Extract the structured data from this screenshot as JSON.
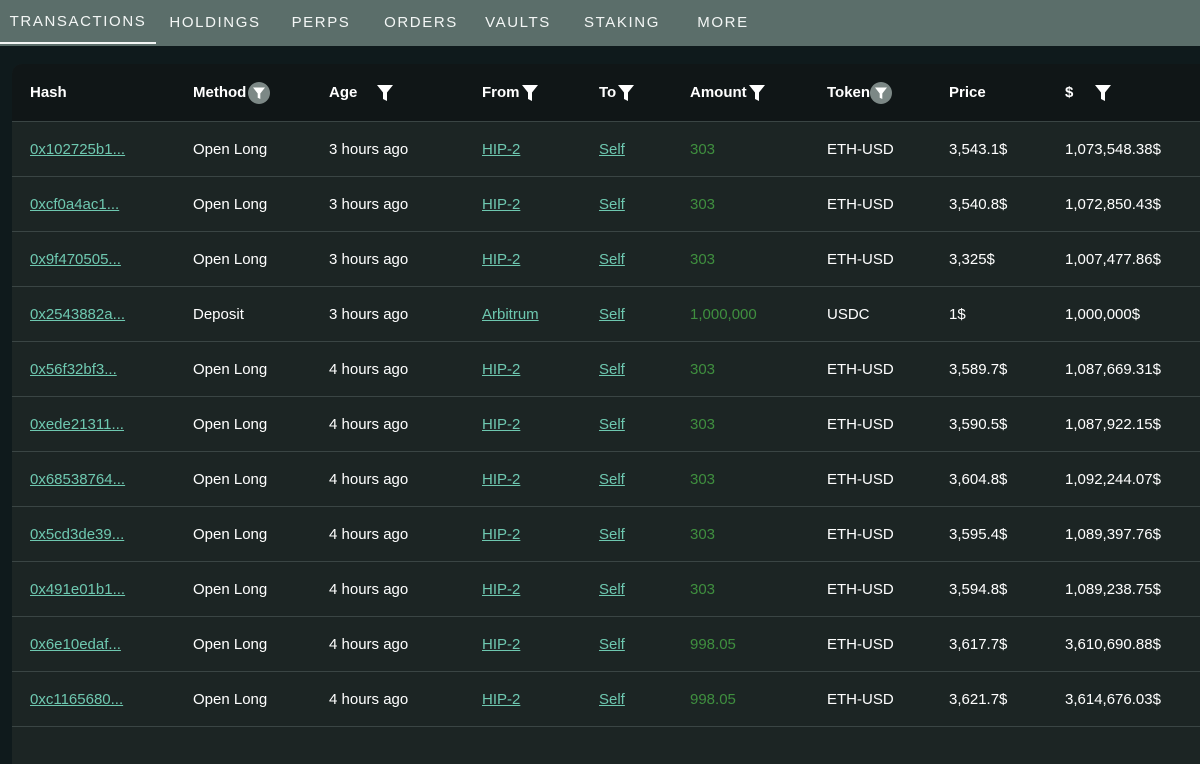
{
  "tabs": [
    {
      "label": "TRANSACTIONS",
      "active": true
    },
    {
      "label": "HOLDINGS",
      "active": false
    },
    {
      "label": "PERPS",
      "active": false
    },
    {
      "label": "ORDERS",
      "active": false
    },
    {
      "label": "VAULTS",
      "active": false
    },
    {
      "label": "STAKING",
      "active": false
    },
    {
      "label": "MORE",
      "active": false
    }
  ],
  "table": {
    "columns": {
      "hash": "Hash",
      "method": "Method",
      "age": "Age",
      "from": "From",
      "to": "To",
      "amount": "Amount",
      "token": "Token",
      "price": "Price",
      "usd": "$"
    },
    "rows": [
      {
        "hash": "0x102725b1...",
        "method": "Open Long",
        "age": "3 hours ago",
        "from": "HIP-2",
        "to": "Self",
        "amount": "303",
        "token": "ETH-USD",
        "price": "3,543.1$",
        "usd": "1,073,548.38$"
      },
      {
        "hash": "0xcf0a4ac1...",
        "method": "Open Long",
        "age": "3 hours ago",
        "from": "HIP-2",
        "to": "Self",
        "amount": "303",
        "token": "ETH-USD",
        "price": "3,540.8$",
        "usd": "1,072,850.43$"
      },
      {
        "hash": "0x9f470505...",
        "method": "Open Long",
        "age": "3 hours ago",
        "from": "HIP-2",
        "to": "Self",
        "amount": "303",
        "token": "ETH-USD",
        "price": "3,325$",
        "usd": "1,007,477.86$"
      },
      {
        "hash": "0x2543882a...",
        "method": "Deposit",
        "age": "3 hours ago",
        "from": "Arbitrum",
        "to": "Self",
        "amount": "1,000,000",
        "token": "USDC",
        "price": "1$",
        "usd": "1,000,000$"
      },
      {
        "hash": "0x56f32bf3...",
        "method": "Open Long",
        "age": "4 hours ago",
        "from": "HIP-2",
        "to": "Self",
        "amount": "303",
        "token": "ETH-USD",
        "price": "3,589.7$",
        "usd": "1,087,669.31$"
      },
      {
        "hash": "0xede21311...",
        "method": "Open Long",
        "age": "4 hours ago",
        "from": "HIP-2",
        "to": "Self",
        "amount": "303",
        "token": "ETH-USD",
        "price": "3,590.5$",
        "usd": "1,087,922.15$"
      },
      {
        "hash": "0x68538764...",
        "method": "Open Long",
        "age": "4 hours ago",
        "from": "HIP-2",
        "to": "Self",
        "amount": "303",
        "token": "ETH-USD",
        "price": "3,604.8$",
        "usd": "1,092,244.07$"
      },
      {
        "hash": "0x5cd3de39...",
        "method": "Open Long",
        "age": "4 hours ago",
        "from": "HIP-2",
        "to": "Self",
        "amount": "303",
        "token": "ETH-USD",
        "price": "3,595.4$",
        "usd": "1,089,397.76$"
      },
      {
        "hash": "0x491e01b1...",
        "method": "Open Long",
        "age": "4 hours ago",
        "from": "HIP-2",
        "to": "Self",
        "amount": "303",
        "token": "ETH-USD",
        "price": "3,594.8$",
        "usd": "1,089,238.75$"
      },
      {
        "hash": "0x6e10edaf...",
        "method": "Open Long",
        "age": "4 hours ago",
        "from": "HIP-2",
        "to": "Self",
        "amount": "998.05",
        "token": "ETH-USD",
        "price": "3,617.7$",
        "usd": "3,610,690.88$"
      },
      {
        "hash": "0xc1165680...",
        "method": "Open Long",
        "age": "4 hours ago",
        "from": "HIP-2",
        "to": "Self",
        "amount": "998.05",
        "token": "ETH-USD",
        "price": "3,621.7$",
        "usd": "3,614,676.03$"
      }
    ]
  },
  "icons": {
    "filter": "filter-icon",
    "filter_active": "filter-active-icon"
  },
  "colors": {
    "tabbar_bg": "#5b6e6a",
    "header_bg": "#101617",
    "body_bg": "#1c2524",
    "link": "#6ec8b0",
    "amount": "#3f8f3f",
    "filter_active_circle": "#7c8886"
  }
}
